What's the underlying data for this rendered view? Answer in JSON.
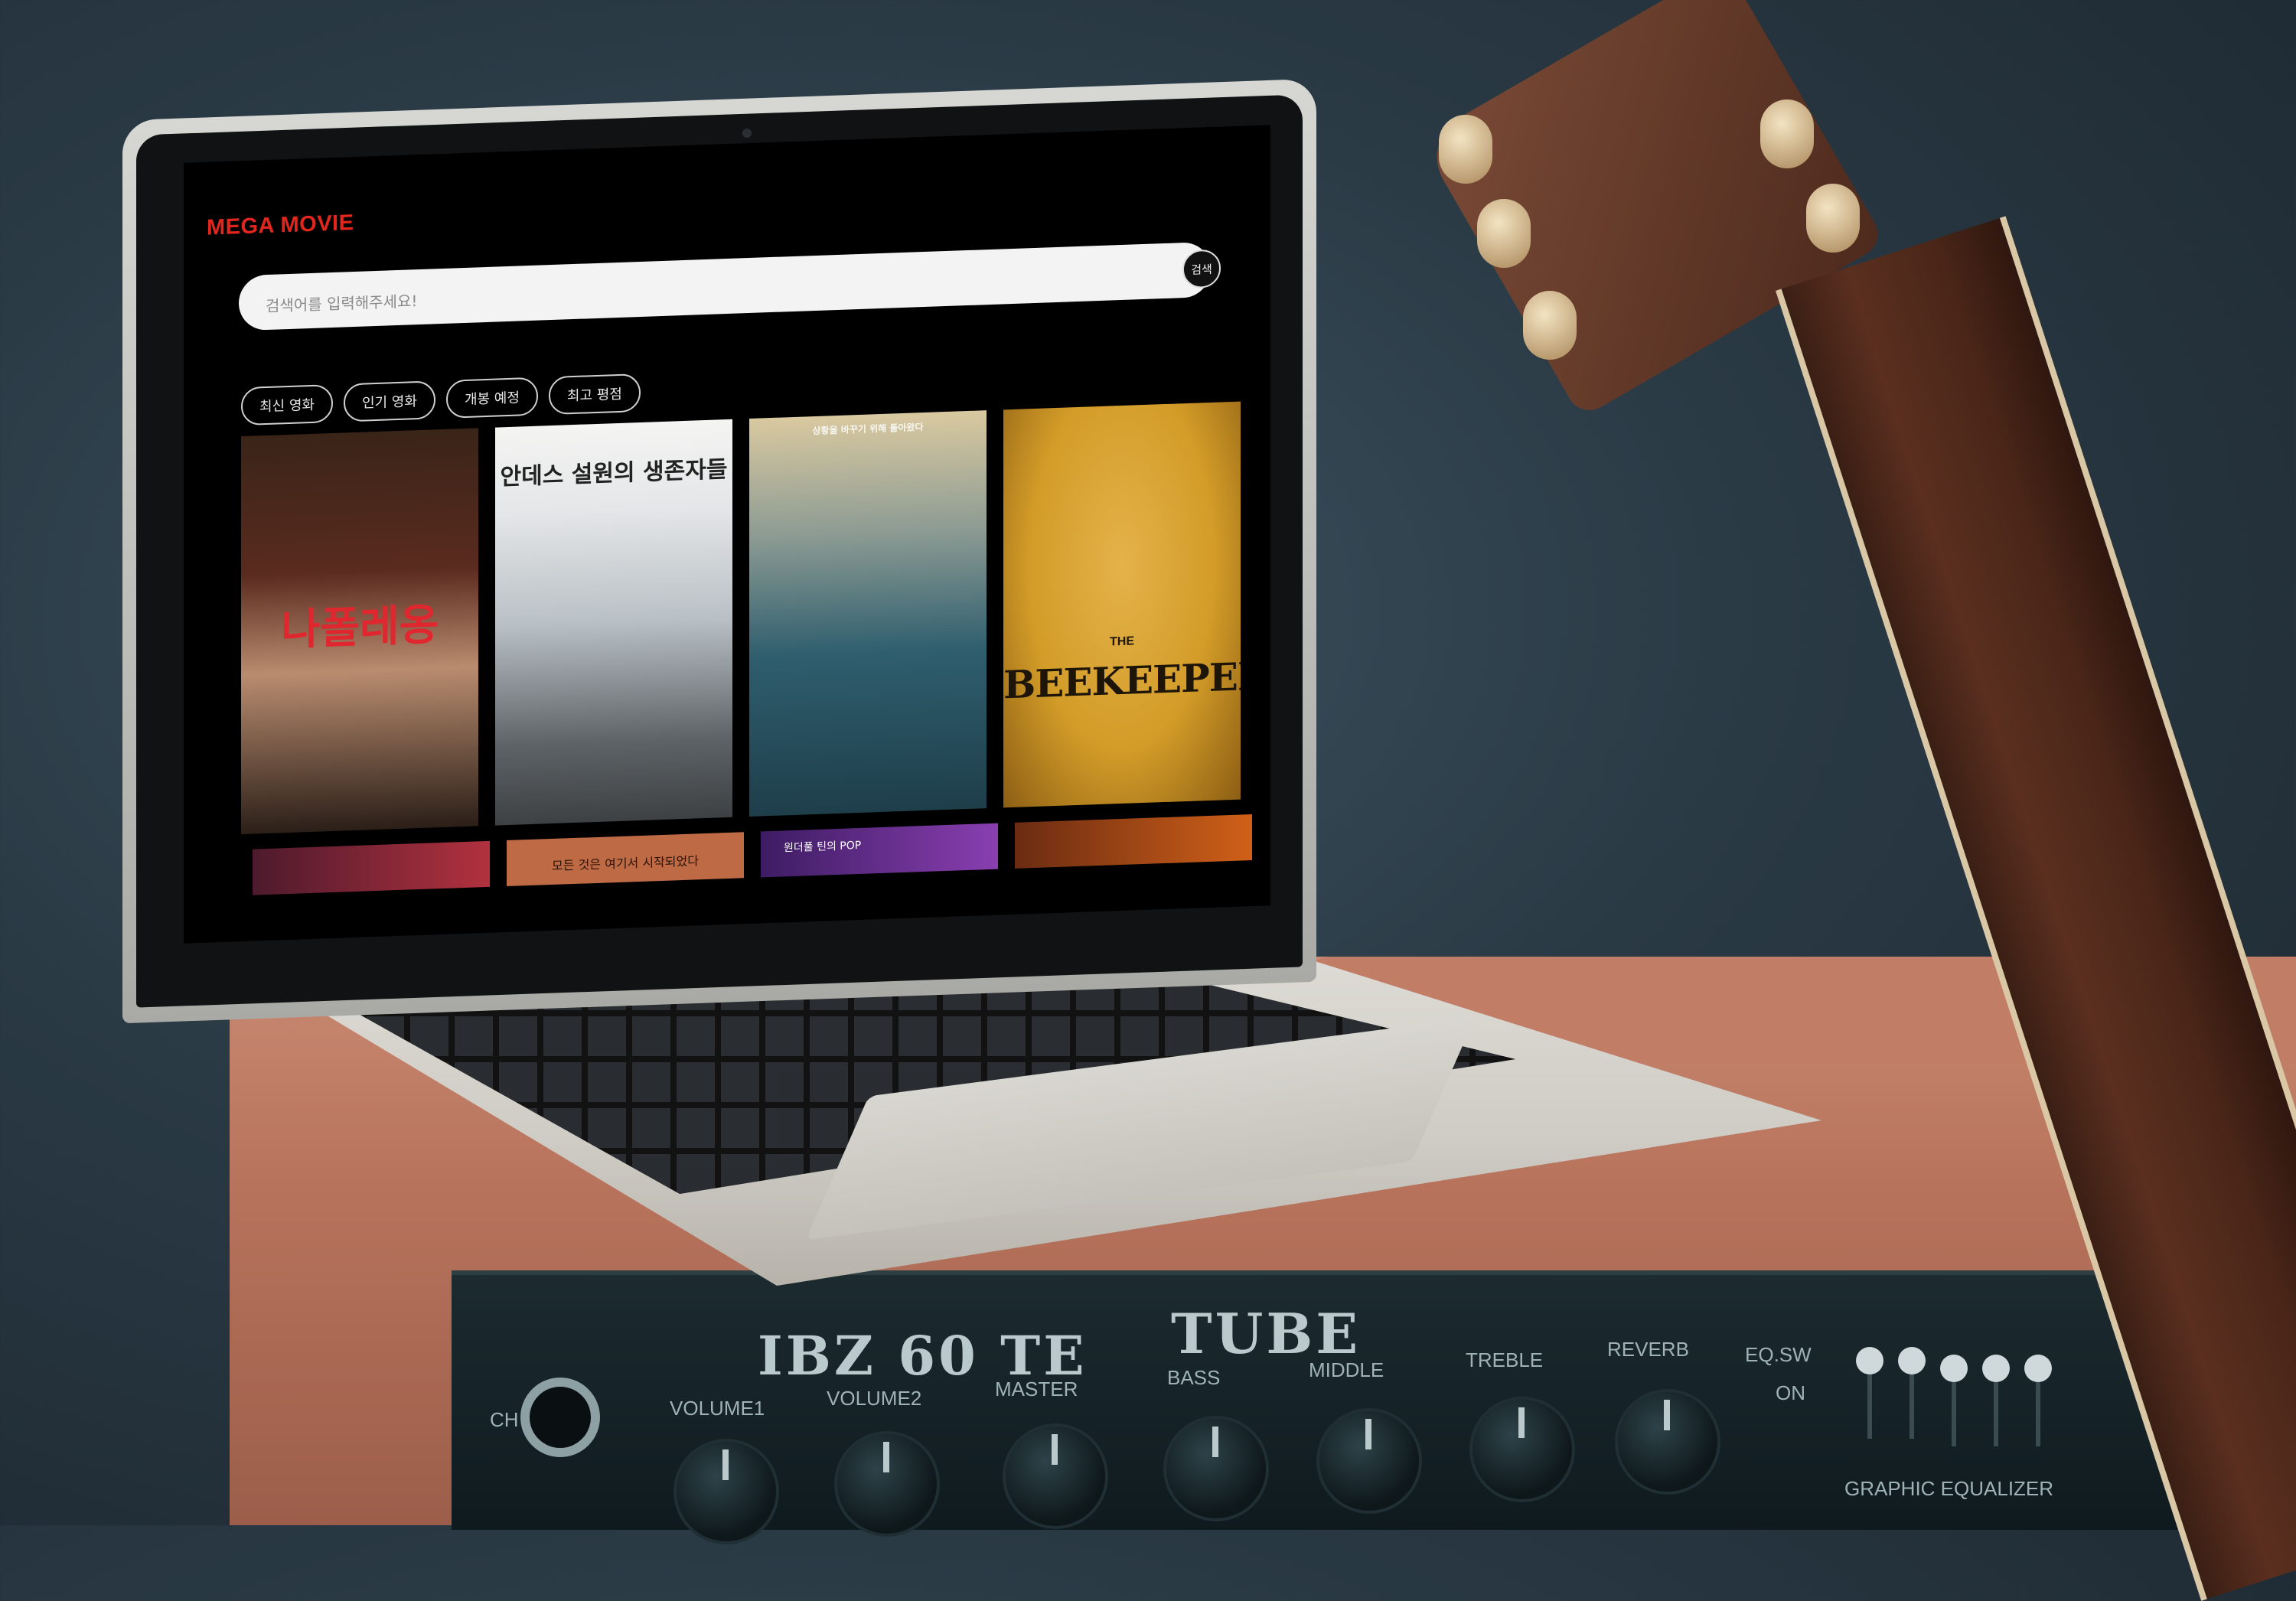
{
  "app": {
    "logo": "MEGA MOVIE",
    "search": {
      "placeholder": "검색어를 입력해주세요!",
      "button_label": "검색"
    },
    "tabs": [
      {
        "label": "최신 영화"
      },
      {
        "label": "인기 영화"
      },
      {
        "label": "개봉 예정"
      },
      {
        "label": "최고 평점"
      }
    ],
    "posters": [
      {
        "title": "나폴레옹"
      },
      {
        "title": "안데스 설원의 생존자들"
      },
      {
        "title": "상황을 바꾸기 위해 돌아왔다"
      },
      {
        "title": "BEEKEEPER",
        "subtitle": "THE"
      }
    ],
    "posters_row2": [
      {
        "title": ""
      },
      {
        "title": "모든 것은 여기서 시작되었다"
      },
      {
        "title": "원더풀 틴의 POP"
      },
      {
        "title": ""
      }
    ]
  },
  "scene": {
    "amp": {
      "brand": "IBZ 60 TE",
      "tube": "TUBE",
      "labels": [
        "VOLUME1",
        "VOLUME2",
        "MASTER",
        "BASS",
        "MIDDLE",
        "TREBLE",
        "REVERB",
        "EQ.SW",
        "ON",
        "GRAPHIC EQUALIZER",
        "CH"
      ]
    }
  }
}
